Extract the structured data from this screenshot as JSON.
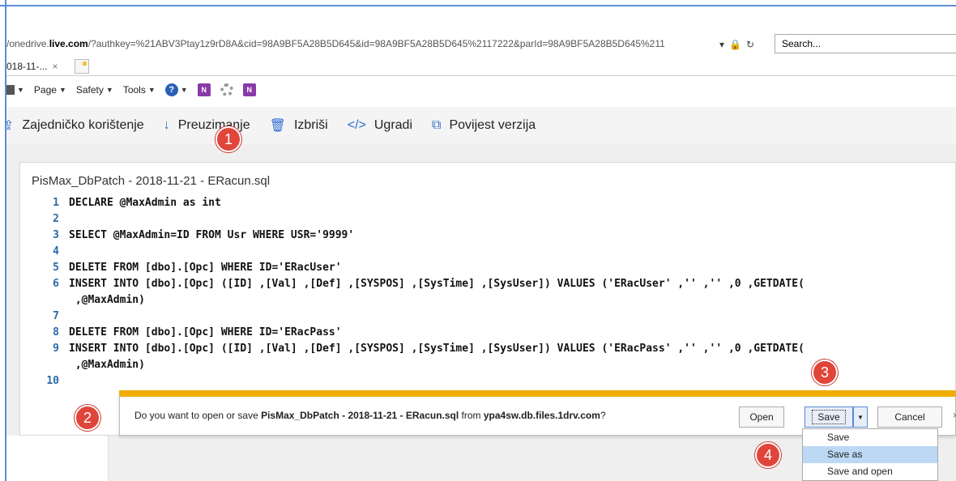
{
  "browser": {
    "address_prefix": "/onedrive.",
    "address_bold": "live.com",
    "address_rest": "/?authkey=%21ABV3Ptay1z9rD8A&cid=98A9BF5A28B5D645&id=98A9BF5A28B5D645%2117222&parId=98A9BF5A28B5D645%211",
    "search_placeholder": "Search...",
    "tab_title": "018-11-...",
    "tab_close": "×"
  },
  "command_bar": {
    "page_label": "Page",
    "safety_label": "Safety",
    "tools_label": "Tools",
    "help_glyph": "?",
    "onenote_glyph": "N"
  },
  "onedrive_bar": {
    "share_label": "Zajedničko korištenje",
    "download_label": "Preuzimanje",
    "delete_label": "Izbriši",
    "embed_label": "Ugradi",
    "history_label": "Povijest verzija",
    "share_icon": "share-icon",
    "download_icon": "download-icon",
    "delete_icon": "trash-icon",
    "embed_icon": "code-icon",
    "history_icon": "version-history-icon"
  },
  "file": {
    "title": "PisMax_DbPatch - 2018-11-21 - ERacun.sql",
    "lines": [
      {
        "n": "1",
        "text": "DECLARE @MaxAdmin as int"
      },
      {
        "n": "2",
        "text": ""
      },
      {
        "n": "3",
        "text": "SELECT @MaxAdmin=ID FROM Usr WHERE USR='9999'"
      },
      {
        "n": "4",
        "text": ""
      },
      {
        "n": "5",
        "text": "DELETE FROM [dbo].[Opc] WHERE ID='ERacUser'"
      },
      {
        "n": "6",
        "text": "INSERT INTO [dbo].[Opc] ([ID] ,[Val] ,[Def] ,[SYSPOS] ,[SysTime] ,[SysUser]) VALUES ('ERacUser' ,'' ,'' ,0 ,GETDATE("
      },
      {
        "n": "",
        "text": " ,@MaxAdmin)"
      },
      {
        "n": "7",
        "text": ""
      },
      {
        "n": "8",
        "text": "DELETE FROM [dbo].[Opc] WHERE ID='ERacPass'"
      },
      {
        "n": "9",
        "text": "INSERT INTO [dbo].[Opc] ([ID] ,[Val] ,[Def] ,[SYSPOS] ,[SysTime] ,[SysUser]) VALUES ('ERacPass' ,'' ,'' ,0 ,GETDATE("
      },
      {
        "n": "",
        "text": " ,@MaxAdmin)"
      },
      {
        "n": "10",
        "text": ""
      }
    ]
  },
  "notification": {
    "prefix": "Do you want to open or save ",
    "filename": "PisMax_DbPatch - 2018-11-21 - ERacun.sql",
    "middle": " from ",
    "host": "ypa4sw.db.files.1drv.com",
    "suffix": "?",
    "open_label": "Open",
    "save_label": "Save",
    "cancel_label": "Cancel",
    "close_glyph": "×"
  },
  "save_menu": {
    "items": [
      "Save",
      "Save as",
      "Save and open"
    ],
    "selected": "Save as"
  },
  "markers": {
    "one": "1",
    "two": "2",
    "three": "3",
    "four": "4"
  },
  "colors": {
    "marker": "#e0453a",
    "notification_accent": "#f0ad00",
    "accent_blue": "#2b6cd0",
    "selected_item": "#bcd8f4"
  }
}
